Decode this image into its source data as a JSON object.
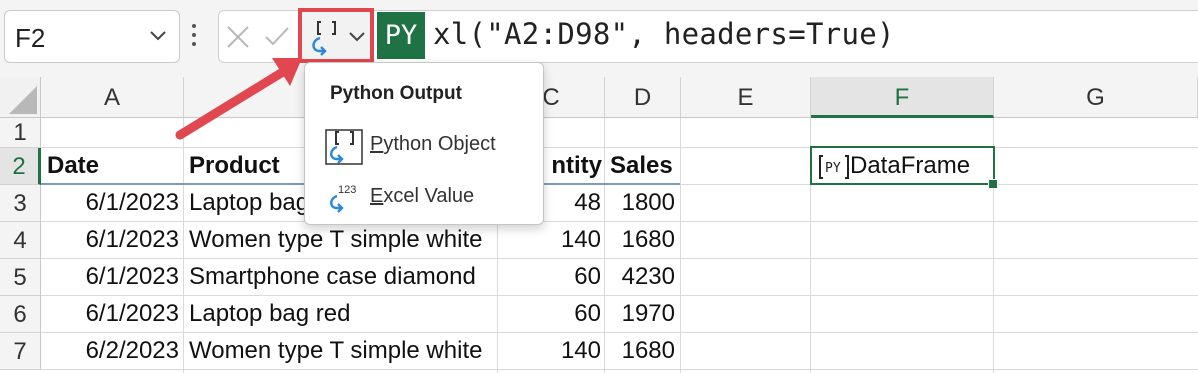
{
  "formula_bar": {
    "name_box": "F2",
    "py_badge": "PY",
    "formula": "xl(\"A2:D98\", headers=True)"
  },
  "columns": [
    "A",
    "B",
    "C",
    "D",
    "E",
    "F",
    "G"
  ],
  "rows": [
    "1",
    "2",
    "3",
    "4",
    "5",
    "6",
    "7"
  ],
  "table": {
    "headers": [
      "Date",
      "Product",
      "ntity",
      "Sales"
    ],
    "rows": [
      [
        "6/1/2023",
        "Laptop bag",
        "48",
        "1800"
      ],
      [
        "6/1/2023",
        "Women type T simple white",
        "140",
        "1680"
      ],
      [
        "6/1/2023",
        "Smartphone case diamond",
        "60",
        "4230"
      ],
      [
        "6/1/2023",
        "Laptop bag red",
        "60",
        "1970"
      ],
      [
        "6/2/2023",
        "Women type T simple white",
        "140",
        "1680"
      ]
    ]
  },
  "selected_cell": {
    "ref": "F2",
    "value": "DataFrame"
  },
  "python_output_menu": {
    "title": "Python Output",
    "items": [
      {
        "label_underlined": "P",
        "label_rest": "ython Object",
        "icon": "python-object-icon"
      },
      {
        "label_underlined": "E",
        "label_rest": "xcel Value",
        "icon": "excel-value-icon"
      }
    ]
  },
  "colors": {
    "excel_green": "#1f7244",
    "highlight_red": "#e0474f",
    "python_blue": "#2b88d8"
  }
}
